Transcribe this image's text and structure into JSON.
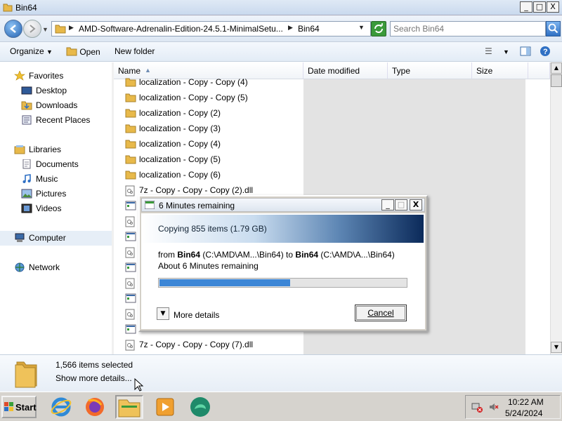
{
  "window": {
    "title": "Bin64",
    "controls": [
      "_",
      "□",
      "X"
    ]
  },
  "address": {
    "crumbs": [
      "AMD-Software-Adrenalin-Edition-24.5.1-MinimalSetu...",
      "Bin64"
    ],
    "search_placeholder": "Search Bin64"
  },
  "toolbar": {
    "organize": "Organize",
    "open": "Open",
    "new_folder": "New folder"
  },
  "nav": {
    "favorites": "Favorites",
    "desktop": "Desktop",
    "downloads": "Downloads",
    "recent": "Recent Places",
    "libraries": "Libraries",
    "documents": "Documents",
    "music": "Music",
    "pictures": "Pictures",
    "videos": "Videos",
    "computer": "Computer",
    "network": "Network"
  },
  "columns": {
    "name": "Name",
    "date": "Date modified",
    "type": "Type",
    "size": "Size"
  },
  "files": [
    {
      "name": "localization - Copy - Copy (4)",
      "kind": "folder"
    },
    {
      "name": "localization - Copy - Copy (5)",
      "kind": "folder"
    },
    {
      "name": "localization - Copy (2)",
      "kind": "folder"
    },
    {
      "name": "localization - Copy (3)",
      "kind": "folder"
    },
    {
      "name": "localization - Copy (4)",
      "kind": "folder"
    },
    {
      "name": "localization - Copy (5)",
      "kind": "folder"
    },
    {
      "name": "localization - Copy (6)",
      "kind": "folder"
    },
    {
      "name": "7z - Copy - Copy - Copy (2).dll",
      "kind": "dll"
    },
    {
      "name": "",
      "kind": "exe"
    },
    {
      "name": "",
      "kind": "dll"
    },
    {
      "name": "",
      "kind": "exe"
    },
    {
      "name": "",
      "kind": "dll"
    },
    {
      "name": "",
      "kind": "exe"
    },
    {
      "name": "",
      "kind": "dll"
    },
    {
      "name": "",
      "kind": "exe"
    },
    {
      "name": "",
      "kind": "dll"
    },
    {
      "name": "",
      "kind": "exe"
    },
    {
      "name": "7z - Copy - Copy - Copy (7).dll",
      "kind": "dll"
    }
  ],
  "details": {
    "selected": "1,566 items selected",
    "more": "Show more details..."
  },
  "dialog": {
    "title": "6 Minutes remaining",
    "heading": "Copying 855 items (1.79 GB)",
    "from_label": "from ",
    "src": "Bin64",
    "src_path": " (C:\\AMD\\AM...\\Bin64) to ",
    "dst": "Bin64",
    "dst_path": " (C:\\AMD\\A...\\Bin64)",
    "remaining": "About 6 Minutes remaining",
    "progress": 0.53,
    "more_details": "More details",
    "cancel": "Cancel"
  },
  "taskbar": {
    "start": "Start",
    "time": "10:22 AM",
    "date": "5/24/2024"
  },
  "colors": {
    "accent": "#3c86d6",
    "folder": "#e8b94a"
  }
}
